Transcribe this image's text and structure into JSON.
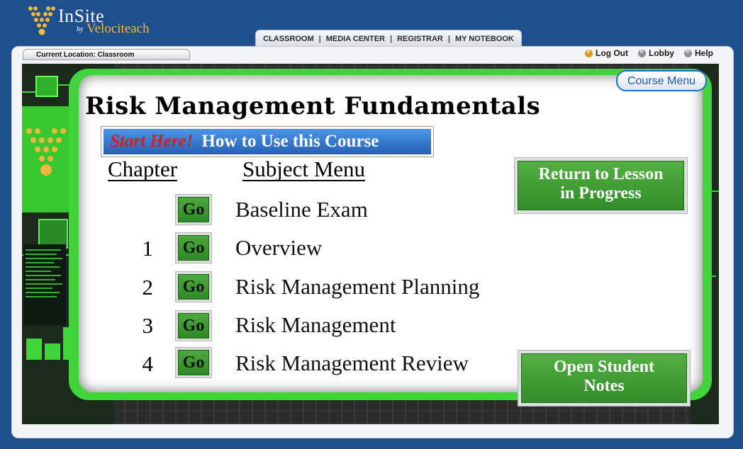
{
  "brand": {
    "name": "InSite",
    "by": "by",
    "company": "Velociteach"
  },
  "topnav": [
    "CLASSROOM",
    "MEDIA CENTER",
    "REGISTRAR",
    "MY NOTEBOOK"
  ],
  "location": "Current Location: Classroom",
  "links": {
    "logout": "Log Out",
    "lobby": "Lobby",
    "help": "Help"
  },
  "course": {
    "title": "Risk Management Fundamentals",
    "course_menu": "Course Menu",
    "start_here": "Start Here!",
    "how_to": "How to Use this Course",
    "col_chapter": "Chapter",
    "col_subject": "Subject Menu",
    "go_label": "Go",
    "rows": [
      {
        "chapter": "",
        "subject": "Baseline Exam"
      },
      {
        "chapter": "1",
        "subject": "Overview"
      },
      {
        "chapter": "2",
        "subject": "Risk Management Planning"
      },
      {
        "chapter": "3",
        "subject": "Risk Management"
      },
      {
        "chapter": "4",
        "subject": "Risk Management Review"
      }
    ],
    "return_lesson": [
      "Return to Lesson",
      "in Progress"
    ],
    "open_notes": [
      "Open Student",
      "Notes"
    ]
  },
  "colors": {
    "background": "#1d4f8c",
    "accent_green": "#3fd43a",
    "button_blue": "#2f73c9",
    "logo_orange": "#f3b73c"
  }
}
